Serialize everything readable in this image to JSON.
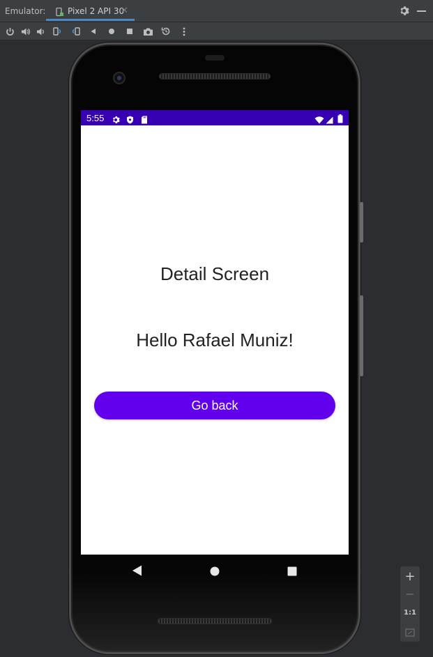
{
  "titlebar": {
    "label": "Emulator:",
    "tab_title": "Pixel 2 API 30",
    "tab_close": "✕"
  },
  "toolbar": {
    "tools": [
      "power-icon",
      "volume-up-icon",
      "volume-down-icon",
      "rotate-left-icon",
      "rotate-right-icon",
      "back-icon",
      "home-icon",
      "overview-icon",
      "screenshot-icon",
      "snapshot-icon",
      "more-icon"
    ]
  },
  "device": {
    "status_bar": {
      "time": "5:55",
      "left_icons": [
        "settings-icon",
        "shield-icon",
        "sd-card-icon"
      ],
      "right_icons": [
        "wifi-icon",
        "signal-icon",
        "battery-icon"
      ],
      "color": "#3700b3"
    },
    "screen": {
      "title": "Detail Screen",
      "greeting": "Hello Rafael Muniz!",
      "button_label": "Go back",
      "button_color": "#6200ee"
    }
  },
  "zoom": {
    "zoom_in": "+",
    "zoom_out": "−",
    "actual_size": "1:1"
  }
}
